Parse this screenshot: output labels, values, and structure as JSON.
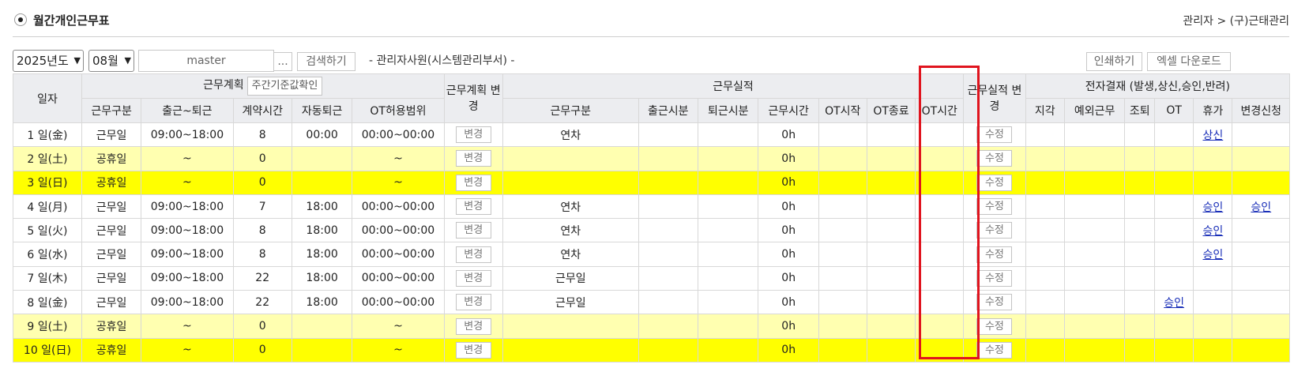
{
  "header": {
    "title": "월간개인근무표",
    "breadcrumb": "관리자 > (구)근태관리"
  },
  "toolbar": {
    "year": "2025년도",
    "month": "08월",
    "search_value": "master",
    "dots_label": "...",
    "search_label": "검색하기",
    "employee_info": "- 관리자사원(시스템관리부서) -",
    "print_label": "인쇄하기",
    "excel_label": "엑셀 다운로드"
  },
  "table": {
    "headers": {
      "date": "일자",
      "plan_group": "근무계획",
      "weekly_check": "주간기준값확인",
      "plan_change": "근무계획 변경",
      "actual_group": "근무실적",
      "actual_change": "근무실적 변경",
      "approval_group": "전자결재 (발생,상신,승인,반려)",
      "plan_cols": [
        "근무구분",
        "출근~퇴근",
        "계약시간",
        "자동퇴근",
        "OT허용범위"
      ],
      "actual_cols": [
        "근무구분",
        "출근시분",
        "퇴근시분",
        "근무시간",
        "OT시작",
        "OT종료",
        "OT시간"
      ],
      "approval_cols": [
        "지각",
        "예외근무",
        "조퇴",
        "OT",
        "휴가",
        "변경신청"
      ]
    },
    "plan_btn": "변경",
    "actual_btn": "수정",
    "rows": [
      {
        "date": "1 일(金)",
        "kind": "근무일",
        "time": "09:00~18:00",
        "contract": "8",
        "auto": "00:00",
        "ot": "00:00~00:00",
        "actual_kind": "연차",
        "work_hours": "0h",
        "ap_ot": "",
        "ap_leave": "상신",
        "ap_change": "",
        "day": "weekday"
      },
      {
        "date": "2 일(土)",
        "kind": "공휴일",
        "time": "~",
        "contract": "0",
        "auto": "",
        "ot": "~",
        "actual_kind": "",
        "work_hours": "0h",
        "ap_ot": "",
        "ap_leave": "",
        "ap_change": "",
        "day": "sat"
      },
      {
        "date": "3 일(日)",
        "kind": "공휴일",
        "time": "~",
        "contract": "0",
        "auto": "",
        "ot": "~",
        "actual_kind": "",
        "work_hours": "0h",
        "ap_ot": "",
        "ap_leave": "",
        "ap_change": "",
        "day": "sun"
      },
      {
        "date": "4 일(月)",
        "kind": "근무일",
        "time": "09:00~18:00",
        "contract": "7",
        "auto": "18:00",
        "ot": "00:00~00:00",
        "actual_kind": "연차",
        "work_hours": "0h",
        "ap_ot": "",
        "ap_leave": "승인",
        "ap_change": "승인",
        "day": "weekday"
      },
      {
        "date": "5 일(火)",
        "kind": "근무일",
        "time": "09:00~18:00",
        "contract": "8",
        "auto": "18:00",
        "ot": "00:00~00:00",
        "actual_kind": "연차",
        "work_hours": "0h",
        "ap_ot": "",
        "ap_leave": "승인",
        "ap_change": "",
        "day": "weekday"
      },
      {
        "date": "6 일(水)",
        "kind": "근무일",
        "time": "09:00~18:00",
        "contract": "8",
        "auto": "18:00",
        "ot": "00:00~00:00",
        "actual_kind": "연차",
        "work_hours": "0h",
        "ap_ot": "",
        "ap_leave": "승인",
        "ap_change": "",
        "day": "weekday"
      },
      {
        "date": "7 일(木)",
        "kind": "근무일",
        "time": "09:00~18:00",
        "contract": "22",
        "auto": "18:00",
        "ot": "00:00~00:00",
        "actual_kind": "근무일",
        "work_hours": "0h",
        "ap_ot": "",
        "ap_leave": "",
        "ap_change": "",
        "day": "weekday"
      },
      {
        "date": "8 일(金)",
        "kind": "근무일",
        "time": "09:00~18:00",
        "contract": "22",
        "auto": "18:00",
        "ot": "00:00~00:00",
        "actual_kind": "근무일",
        "work_hours": "0h",
        "ap_ot": "승인",
        "ap_leave": "",
        "ap_change": "",
        "day": "weekday"
      },
      {
        "date": "9 일(土)",
        "kind": "공휴일",
        "time": "~",
        "contract": "0",
        "auto": "",
        "ot": "~",
        "actual_kind": "",
        "work_hours": "0h",
        "ap_ot": "",
        "ap_leave": "",
        "ap_change": "",
        "day": "sat"
      },
      {
        "date": "10 일(日)",
        "kind": "공휴일",
        "time": "~",
        "contract": "0",
        "auto": "",
        "ot": "~",
        "actual_kind": "",
        "work_hours": "0h",
        "ap_ot": "",
        "ap_leave": "",
        "ap_change": "",
        "day": "sun"
      }
    ]
  },
  "colors": {
    "saturday_row": "#ffffb0",
    "sunday_row": "#ffff00",
    "highlight_border": "#e0141e",
    "link": "#1a2fb8"
  }
}
